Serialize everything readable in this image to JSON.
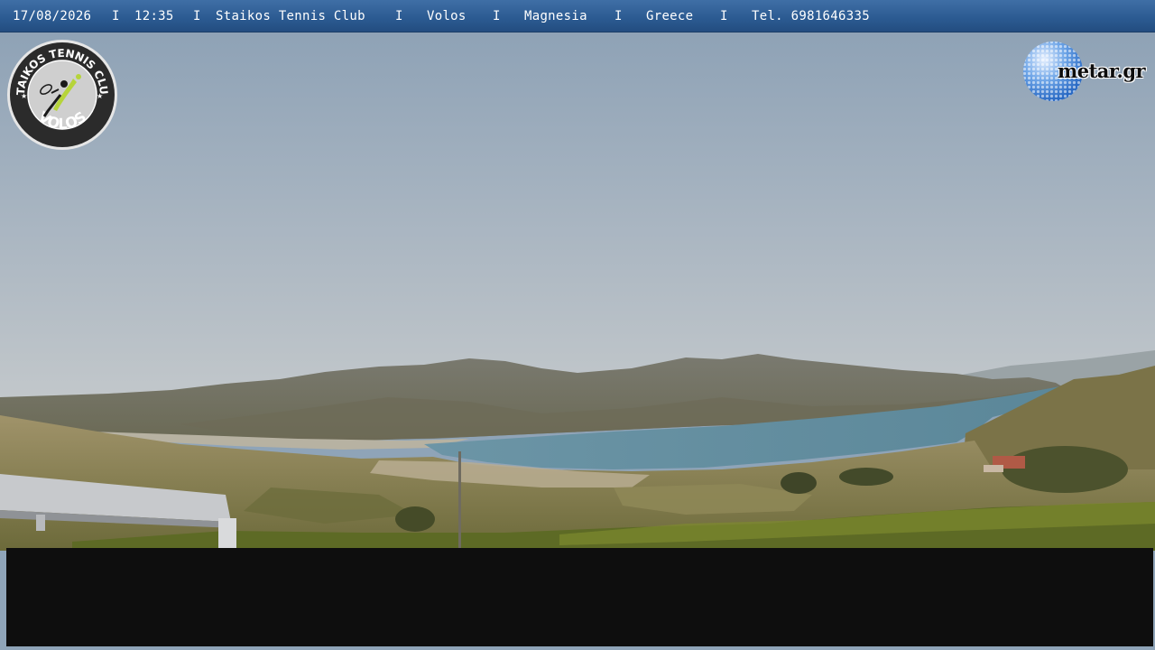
{
  "info_bar": {
    "date": "17/08/2026",
    "time": "12:35",
    "club": "Staikos Tennis Club",
    "city": "Volos",
    "region": "Magnesia",
    "country": "Greece",
    "phone": "Tel. 6981646335",
    "separator": "I"
  },
  "club_logo": {
    "top_text": "STAIKOS TENNIS CLUB",
    "bottom_text": "VOLOS"
  },
  "metar_logo": {
    "text": "metar.gr"
  },
  "colors": {
    "bar_blue": "#2b5a91",
    "sky_top": "#8fa4b8",
    "sea": "#5f8ea3",
    "logo_green": "#b6d43a"
  }
}
